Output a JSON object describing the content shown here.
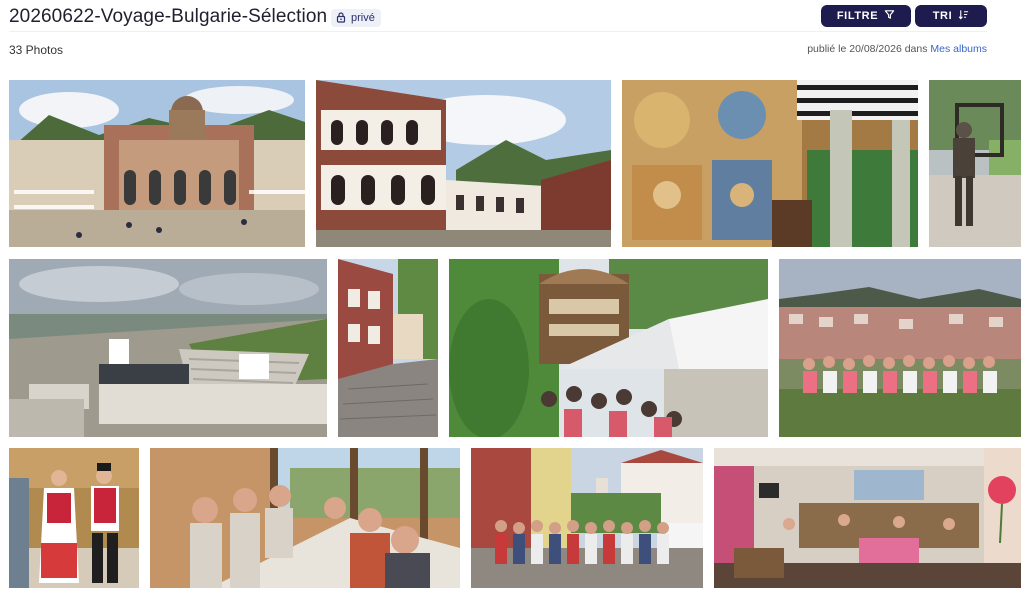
{
  "album": {
    "title": "20260622-Voyage-Bulgarie-Sélection",
    "privacy_label": "privé",
    "photo_count": "33 Photos",
    "published_prefix": "publié le 20/08/2026 dans ",
    "published_link": "Mes albums"
  },
  "toolbar": {
    "filter_label": "FILTRE",
    "sort_label": "TRI"
  },
  "icons": {
    "privacy": "lock-icon",
    "filter": "funnel-icon",
    "sort": "sort-icon"
  },
  "colors": {
    "button_bg": "#1e1c4f",
    "badge_bg": "#eef0f8",
    "link": "#3a66c7"
  },
  "photos": [
    {
      "id": "rila-monastery-church"
    },
    {
      "id": "rila-monastery-arcades"
    },
    {
      "id": "frescoes-and-column"
    },
    {
      "id": "bronze-statue-with-frame"
    },
    {
      "id": "roman-theatre-plovdiv"
    },
    {
      "id": "cobbled-street-red-house"
    },
    {
      "id": "old-house-with-tent-and-group"
    },
    {
      "id": "group-on-hill-viewpoint"
    },
    {
      "id": "dancers-in-costume"
    },
    {
      "id": "group-lunch-at-table"
    },
    {
      "id": "group-in-town-street"
    },
    {
      "id": "shop-interior-with-rose"
    }
  ]
}
